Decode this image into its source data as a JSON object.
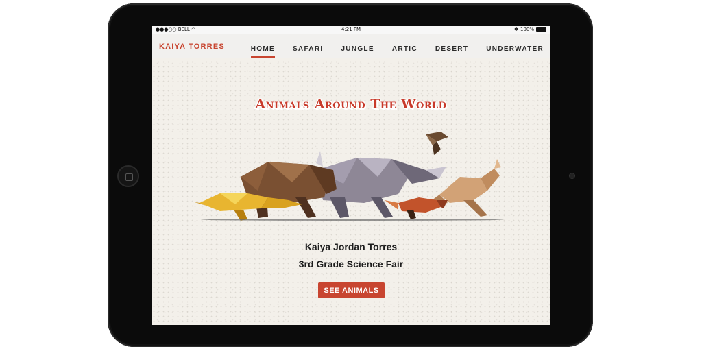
{
  "device": {
    "frame": "tablet"
  },
  "status_bar": {
    "carrier": "BELL",
    "time": "4:21 PM",
    "battery": "100%"
  },
  "header": {
    "brand": "KAIYA TORRES"
  },
  "nav": {
    "items": [
      {
        "label": "HOME",
        "active": true
      },
      {
        "label": "SAFARI",
        "active": false
      },
      {
        "label": "JUNGLE",
        "active": false
      },
      {
        "label": "ARTIC",
        "active": false
      },
      {
        "label": "DESERT",
        "active": false
      },
      {
        "label": "UNDERWATER",
        "active": false
      }
    ]
  },
  "hero": {
    "title": "Animals Around The World",
    "animals": [
      "cheetah",
      "bear",
      "rhino",
      "red panda",
      "kangaroo",
      "eagle"
    ]
  },
  "content": {
    "name": "Kaiya Jordan Torres",
    "subtitle": "3rd Grade Science Fair",
    "cta_label": "SEE ANIMALS"
  },
  "colors": {
    "accent": "#c84530",
    "background": "#f3f0ea",
    "text": "#1e1e1e"
  }
}
